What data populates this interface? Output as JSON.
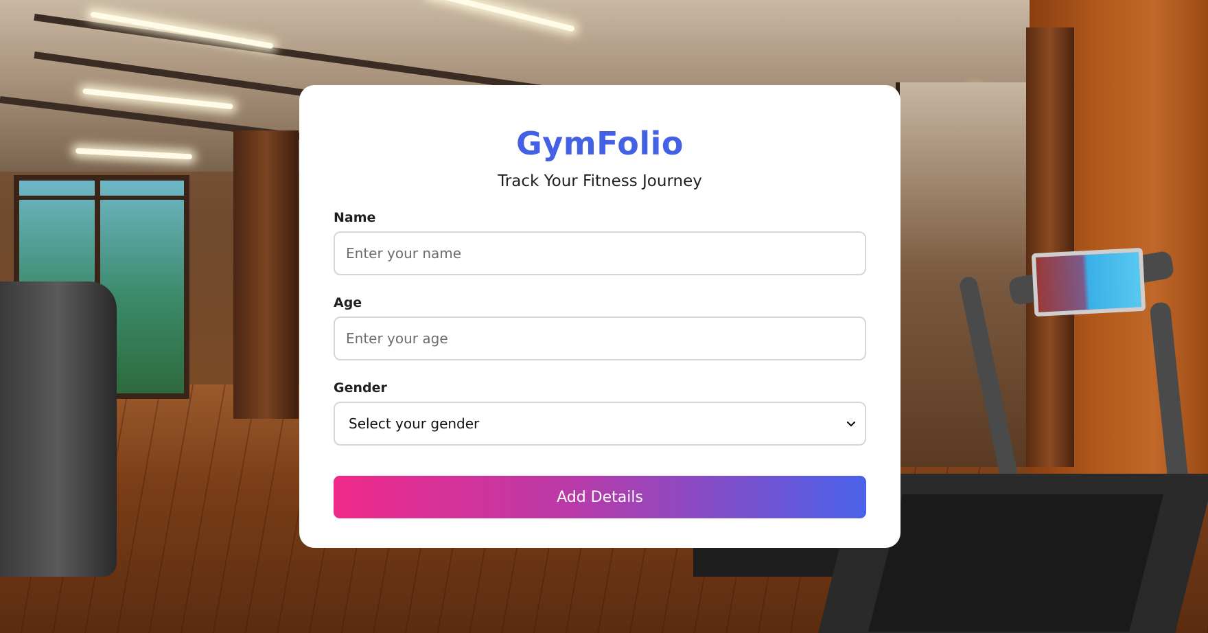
{
  "app": {
    "brand": "GymFolio",
    "tagline": "Track Your Fitness Journey"
  },
  "form": {
    "name": {
      "label": "Name",
      "placeholder": "Enter your name",
      "value": ""
    },
    "age": {
      "label": "Age",
      "placeholder": "Enter your age",
      "value": ""
    },
    "gender": {
      "label": "Gender",
      "selected": "Select your gender",
      "icon": "chevron-down-icon"
    },
    "submit_label": "Add Details"
  },
  "colors": {
    "brand": "#4461e6",
    "button_gradient_start": "#ef2a8a",
    "button_gradient_end": "#4a62ea",
    "card_background": "#ffffff"
  }
}
